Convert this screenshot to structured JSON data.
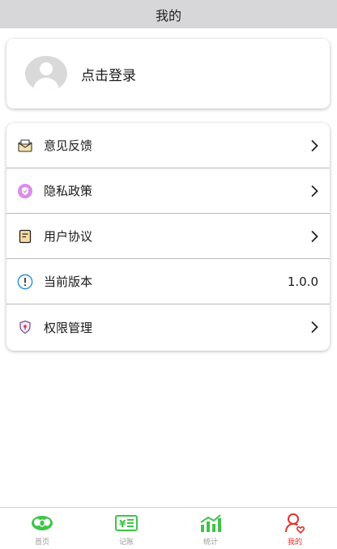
{
  "header": {
    "title": "我的"
  },
  "login": {
    "label": "点击登录",
    "avatar_icon": "avatar-placeholder-icon"
  },
  "menu": {
    "items": [
      {
        "key": "feedback",
        "label": "意见反馈",
        "icon": "feedback-mail-icon",
        "value": ""
      },
      {
        "key": "privacy",
        "label": "隐私政策",
        "icon": "privacy-shield-icon",
        "value": ""
      },
      {
        "key": "agreement",
        "label": "用户协议",
        "icon": "document-icon",
        "value": ""
      },
      {
        "key": "version",
        "label": "当前版本",
        "icon": "info-icon",
        "value": "1.0.0"
      },
      {
        "key": "permissions",
        "label": "权限管理",
        "icon": "permission-shield-icon",
        "value": ""
      }
    ]
  },
  "tabbar": {
    "tabs": [
      {
        "label": "首页",
        "icon": "home-coins-icon",
        "active": false
      },
      {
        "label": "记账",
        "icon": "bookkeeping-icon",
        "active": false
      },
      {
        "label": "统计",
        "icon": "stats-chart-icon",
        "active": false
      },
      {
        "label": "我的",
        "icon": "profile-icon",
        "active": true
      }
    ]
  },
  "colors": {
    "topbar_bg": "#d7d7da",
    "tab_green": "#3fc44a",
    "tab_active": "#e0322f",
    "tab_inactive_text": "#9a9a9a"
  }
}
